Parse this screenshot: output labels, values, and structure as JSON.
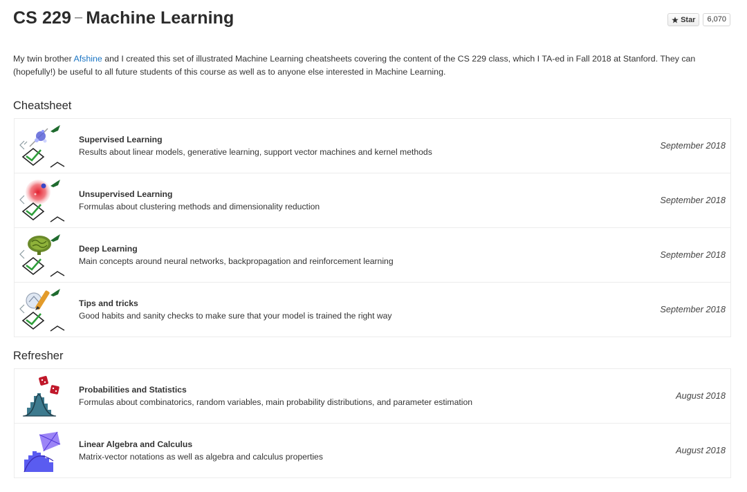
{
  "header": {
    "title_course": "CS 229",
    "title_dash": "–",
    "title_topic": "Machine Learning",
    "github": {
      "star_label": "Star",
      "star_count": "6,070"
    }
  },
  "intro": {
    "before_link": "My twin brother ",
    "link_text": "Afshine",
    "after_link": " and I created this set of illustrated Machine Learning cheatsheets covering the content of the CS 229 class, which I TA-ed in Fall 2018 at Stanford. They can (hopefully!) be useful to all future students of this course as well as to anyone else interested in Machine Learning."
  },
  "sections": {
    "cheatsheet": {
      "title": "Cheatsheet",
      "items": [
        {
          "title": "Supervised Learning",
          "description": "Results about linear models, generative learning, support vector machines and kernel methods",
          "date": "September 2018"
        },
        {
          "title": "Unsupervised Learning",
          "description": "Formulas about clustering methods and dimensionality reduction",
          "date": "September 2018"
        },
        {
          "title": "Deep Learning",
          "description": "Main concepts around neural networks, backpropagation and reinforcement learning",
          "date": "September 2018"
        },
        {
          "title": "Tips and tricks",
          "description": "Good habits and sanity checks to make sure that your model is trained the right way",
          "date": "September 2018"
        }
      ]
    },
    "refresher": {
      "title": "Refresher",
      "items": [
        {
          "title": "Probabilities and Statistics",
          "description": "Formulas about combinatorics, random variables, main probability distributions, and parameter estimation",
          "date": "August 2018"
        },
        {
          "title": "Linear Algebra and Calculus",
          "description": "Matrix-vector notations as well as algebra and calculus properties",
          "date": "August 2018"
        }
      ]
    }
  },
  "colors": {
    "link": "#1a74c3",
    "border": "#ececec",
    "checkmark": "#2e9e3a",
    "leaf": "#1f6b2e",
    "dice": "#c0182a",
    "histogram": "#2f5f73",
    "matrix": "#6a4cf0"
  }
}
